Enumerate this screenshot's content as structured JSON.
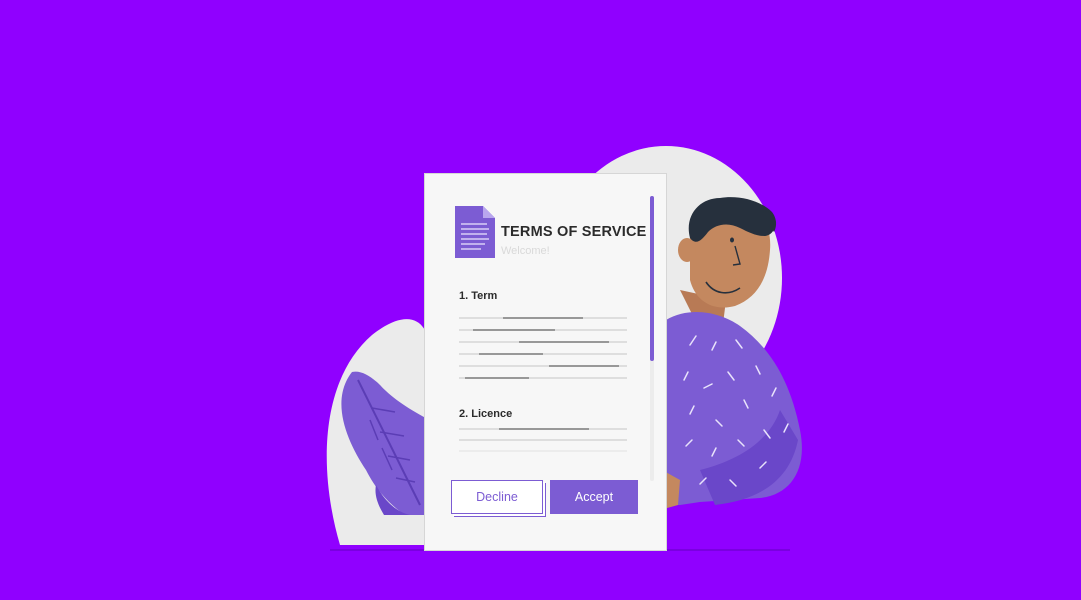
{
  "colors": {
    "background": "#9000ff",
    "accent": "#7c5cd3",
    "card": "#f7f7f7"
  },
  "document": {
    "icon": "document-icon",
    "title": "TERMS OF SERVICE",
    "subtitle": "Welcome!",
    "sections": [
      {
        "heading": "1. Term"
      },
      {
        "heading": "2. Licence"
      }
    ],
    "scroll_position": 0.0
  },
  "actions": {
    "decline_label": "Decline",
    "accept_label": "Accept"
  }
}
